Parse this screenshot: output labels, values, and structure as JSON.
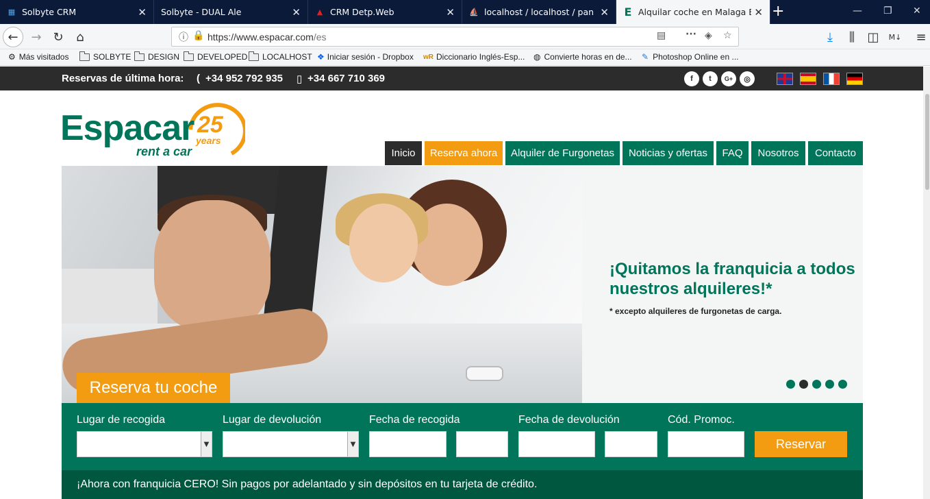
{
  "tabs": [
    {
      "title": "Solbyte CRM",
      "icon": "windows-icon"
    },
    {
      "title": "Solbyte - DUAL Ale",
      "icon": "blank-icon"
    },
    {
      "title": "CRM Detp.Web",
      "icon": "red-triangle-icon"
    },
    {
      "title": "localhost / localhost / panel / u",
      "icon": "phpmyadmin-icon"
    },
    {
      "title": "Alquilar coche en Malaga Estep",
      "icon": "espacar-e-icon"
    }
  ],
  "nav": {
    "url_host": "https://www.espacar.com",
    "url_path": "/es"
  },
  "bookmarks": [
    {
      "label": "Más visitados",
      "icon": "gear-icon"
    },
    {
      "label": "SOLBYTE",
      "icon": "folder-icon"
    },
    {
      "label": "DESIGN",
      "icon": "folder-icon"
    },
    {
      "label": "DEVELOPED",
      "icon": "folder-icon"
    },
    {
      "label": "LOCALHOST",
      "icon": "folder-icon"
    },
    {
      "label": "Iniciar sesión - Dropbox",
      "icon": "dropbox-icon"
    },
    {
      "label": "Diccionario Inglés-Esp...",
      "icon": "wordreference-icon"
    },
    {
      "label": "Convierte horas en de...",
      "icon": "globe-icon"
    },
    {
      "label": "Photoshop Online en ...",
      "icon": "feather-icon"
    }
  ],
  "topbar": {
    "label": "Reservas de última hora:",
    "phone1": "+34 952 792 935",
    "phone2": "+34 667 710 369"
  },
  "logo": {
    "brand": "Espacar",
    "sub": "rent a car",
    "num": "25",
    "years": "years"
  },
  "menu": [
    "Inicio",
    "Reserva ahora",
    "Alquiler de Furgonetas",
    "Noticias y ofertas",
    "FAQ",
    "Nosotros",
    "Contacto"
  ],
  "hero": {
    "headline": "¡Quitamos la franquicia a todos nuestros alquileres!*",
    "note": "* excepto alquileres de furgonetas de carga.",
    "reserva_tab": "Reserva tu coche",
    "active_slide": 2,
    "slides": 5
  },
  "form": {
    "pickup_label": "Lugar de recogida",
    "return_label": "Lugar de devolución",
    "pickup_date_label": "Fecha de recogida",
    "return_date_label": "Fecha de devolución",
    "promo_label": "Cód. Promoc.",
    "submit": "Reservar"
  },
  "banner": "¡Ahora con franquicia CERO! Sin pagos por adelantado y sin depósitos en tu tarjeta de crédito.",
  "colors": {
    "brand_green": "#00755a",
    "accent_orange": "#f39c12",
    "dark": "#2c2c2c"
  }
}
